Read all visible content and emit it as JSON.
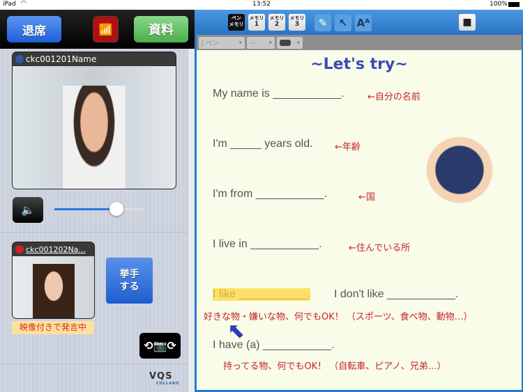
{
  "status_bar": {
    "device": "iPad",
    "time": "13:52",
    "battery": "100%"
  },
  "left_toolbar": {
    "exit_label": "退席",
    "broadcast_icon": "antenna-icon",
    "materials_label": "資料"
  },
  "teacher_video": {
    "name": "ckc001201Name",
    "status_color": "#2a5aa8"
  },
  "volume": {
    "level": 0.7
  },
  "student_video": {
    "name": "ckc001202Na...",
    "status_color": "#d02020",
    "status_text": "映像付きで発言中"
  },
  "raise_hand_label": "挙手\nする",
  "logo": {
    "text": "VQS",
    "sub": "COLLABO"
  },
  "toolbar": {
    "pen_memo": [
      "ペン",
      "メモリ"
    ],
    "memory": [
      [
        "メモリ",
        "1"
      ],
      [
        "メモリ",
        "2"
      ],
      [
        "メモリ",
        "3"
      ]
    ]
  },
  "subtoolbar": {
    "pen_type": "ペン"
  },
  "sheet": {
    "title": "~Let's try~",
    "lines": [
      {
        "text": "My name is ___________.",
        "note": "←自分の名前"
      },
      {
        "text": "I'm _____ years old.",
        "note": "←年齢"
      },
      {
        "text": "I'm from ___________.",
        "note": "←国"
      },
      {
        "text": "I live in ___________.",
        "note": "←住んでいる所"
      }
    ],
    "like_highlight": "I like ___________.",
    "dislike": "I don't like ___________.",
    "like_note": "好きな物・嫌いな物、何でもOK！ （スポーツ、食べ物、動物…）",
    "have": "I have (a) ___________.",
    "have_note": "持ってる物、何でもOK！ （自転車、ピアノ、兄弟…）"
  },
  "colors": {
    "accent": "#2a78c8",
    "highlight": "#ffe066",
    "note": "#c8202a",
    "title": "#3a4ab8"
  }
}
